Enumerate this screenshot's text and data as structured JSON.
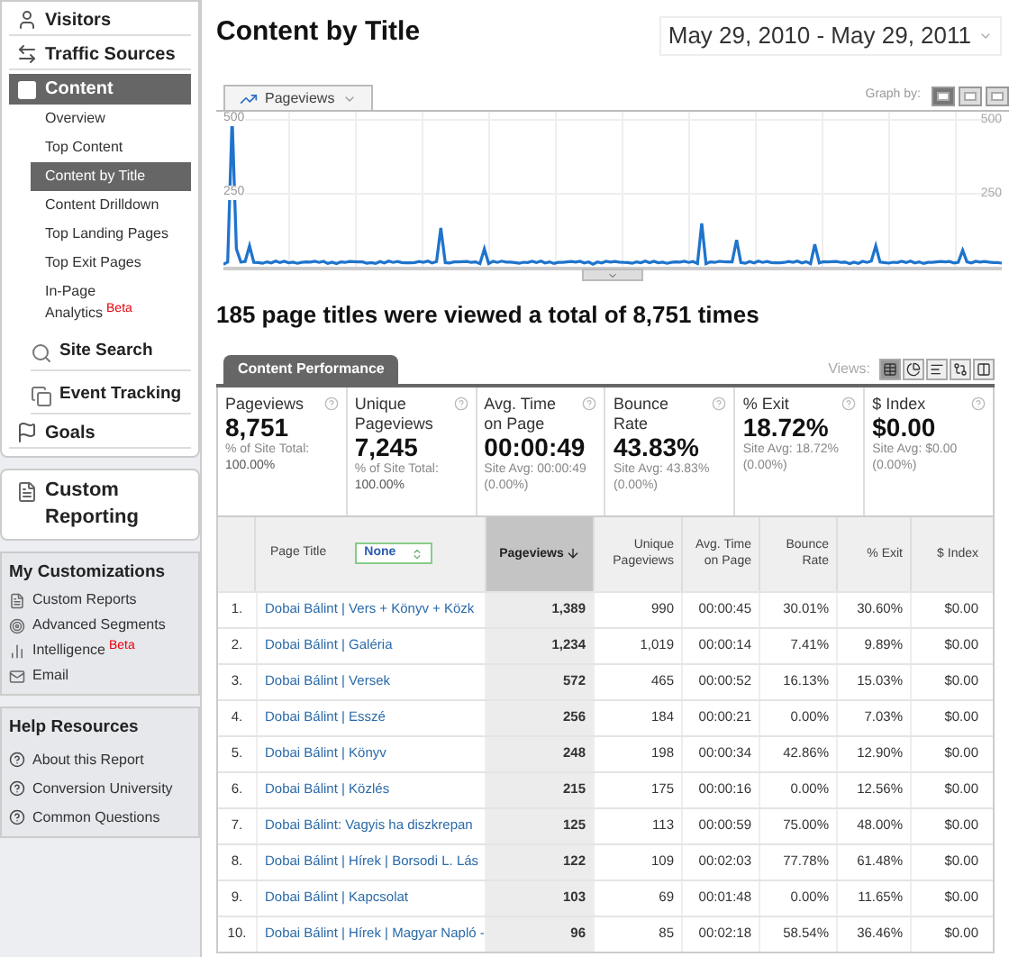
{
  "sidebar": {
    "nav": [
      {
        "label": "Visitors",
        "selected": false
      },
      {
        "label": "Traffic Sources",
        "selected": false
      },
      {
        "label": "Content",
        "selected": true,
        "children": [
          {
            "kind": "link",
            "label": "Overview",
            "selected": false
          },
          {
            "kind": "link",
            "label": "Top Content",
            "selected": false
          },
          {
            "kind": "link",
            "label": "Content by Title",
            "selected": true
          },
          {
            "kind": "link",
            "label": "Content Drilldown",
            "selected": false
          },
          {
            "kind": "link",
            "label": "Top Landing Pages",
            "selected": false
          },
          {
            "kind": "link",
            "label": "Top Exit Pages",
            "selected": false
          },
          {
            "kind": "link",
            "label": "In-Page Analytics",
            "badge": "Beta",
            "selected": false
          },
          {
            "kind": "group",
            "label": "Site Search",
            "selected": false
          },
          {
            "kind": "group",
            "label": "Event Tracking",
            "selected": false
          }
        ]
      },
      {
        "label": "Goals",
        "selected": false
      }
    ],
    "custom_reporting": "Custom Reporting",
    "my_customizations": {
      "title": "My Customizations",
      "items": [
        {
          "label": "Custom Reports"
        },
        {
          "label": "Advanced Segments"
        },
        {
          "label": "Intelligence",
          "badge": "Beta"
        },
        {
          "label": "Email"
        }
      ]
    },
    "help": {
      "title": "Help Resources",
      "items": [
        "About this Report",
        "Conversion University",
        "Common Questions"
      ]
    }
  },
  "header": {
    "title": "Content by Title",
    "date_range": "May 29, 2010 - May 29, 2011"
  },
  "graph": {
    "metric": "Pageviews",
    "graph_by_label": "Graph by:",
    "graph_by": [
      {
        "selected": true
      },
      {
        "selected": false
      },
      {
        "selected": false
      }
    ],
    "left_ticks": [
      "500",
      "250"
    ],
    "right_ticks": [
      "500",
      "250"
    ]
  },
  "summary": "185 page titles were viewed a total of 8,751 times",
  "report": {
    "tab": "Content Performance",
    "views_label": "Views:",
    "views": [
      {
        "selected": true
      },
      {
        "selected": false
      },
      {
        "selected": false
      },
      {
        "selected": false
      },
      {
        "selected": false
      }
    ],
    "metrics": [
      {
        "label": "Pageviews",
        "value": "8,751",
        "note": "% of Site Total:",
        "note_value": "100.00%"
      },
      {
        "label": "Unique Pageviews",
        "value": "7,245",
        "note": "% of Site Total:",
        "note_value": "100.00%"
      },
      {
        "label": "Avg. Time on Page",
        "value": "00:00:49",
        "note": "Site Avg: 00:00:49 (0.00%)"
      },
      {
        "label": "Bounce Rate",
        "value": "43.83%",
        "note": "Site Avg: 43.83% (0.00%)"
      },
      {
        "label": "% Exit",
        "value": "18.72%",
        "note": "Site Avg: 18.72% (0.00%)"
      },
      {
        "label": "$ Index",
        "value": "$0.00",
        "note": "Site Avg: $0.00 (0.00%)"
      }
    ],
    "table": {
      "columns": [
        {
          "selected": false
        },
        {
          "label": "Page Title",
          "selected": false
        },
        {
          "label": "Pageviews",
          "selected": true
        },
        {
          "label": "Unique Pageviews",
          "selected": false
        },
        {
          "label": "Avg. Time on Page",
          "selected": false
        },
        {
          "label": "Bounce Rate",
          "selected": false
        },
        {
          "label": "% Exit",
          "selected": false
        },
        {
          "label": "$ Index",
          "selected": false
        }
      ],
      "secondary_dimension": "None",
      "rows": [
        {
          "cells": [
            "1.",
            "Dobai Bálint | Vers + Könyv + Közk",
            "1,389",
            "990",
            "00:00:45",
            "30.01%",
            "30.60%",
            "$0.00"
          ]
        },
        {
          "cells": [
            "2.",
            "Dobai Bálint | Galéria",
            "1,234",
            "1,019",
            "00:00:14",
            "7.41%",
            "9.89%",
            "$0.00"
          ]
        },
        {
          "cells": [
            "3.",
            "Dobai Bálint | Versek",
            "572",
            "465",
            "00:00:52",
            "16.13%",
            "15.03%",
            "$0.00"
          ]
        },
        {
          "cells": [
            "4.",
            "Dobai Bálint | Esszé",
            "256",
            "184",
            "00:00:21",
            "0.00%",
            "7.03%",
            "$0.00"
          ]
        },
        {
          "cells": [
            "5.",
            "Dobai Bálint | Könyv",
            "248",
            "198",
            "00:00:34",
            "42.86%",
            "12.90%",
            "$0.00"
          ]
        },
        {
          "cells": [
            "6.",
            "Dobai Bálint | Közlés",
            "215",
            "175",
            "00:00:16",
            "0.00%",
            "12.56%",
            "$0.00"
          ]
        },
        {
          "cells": [
            "7.",
            "Dobai Bálint: Vagyis ha diszkrepan",
            "125",
            "113",
            "00:00:59",
            "75.00%",
            "48.00%",
            "$0.00"
          ]
        },
        {
          "cells": [
            "8.",
            "Dobai Bálint | Hírek | Borsodi L. Lás",
            "122",
            "109",
            "00:02:03",
            "77.78%",
            "61.48%",
            "$0.00"
          ]
        },
        {
          "cells": [
            "9.",
            "Dobai Bálint | Kapcsolat",
            "103",
            "69",
            "00:01:48",
            "0.00%",
            "11.65%",
            "$0.00"
          ]
        },
        {
          "cells": [
            "10.",
            "Dobai Bálint | Hírek | Magyar Napló -",
            "96",
            "85",
            "00:02:18",
            "58.54%",
            "36.46%",
            "$0.00"
          ]
        }
      ]
    }
  }
}
